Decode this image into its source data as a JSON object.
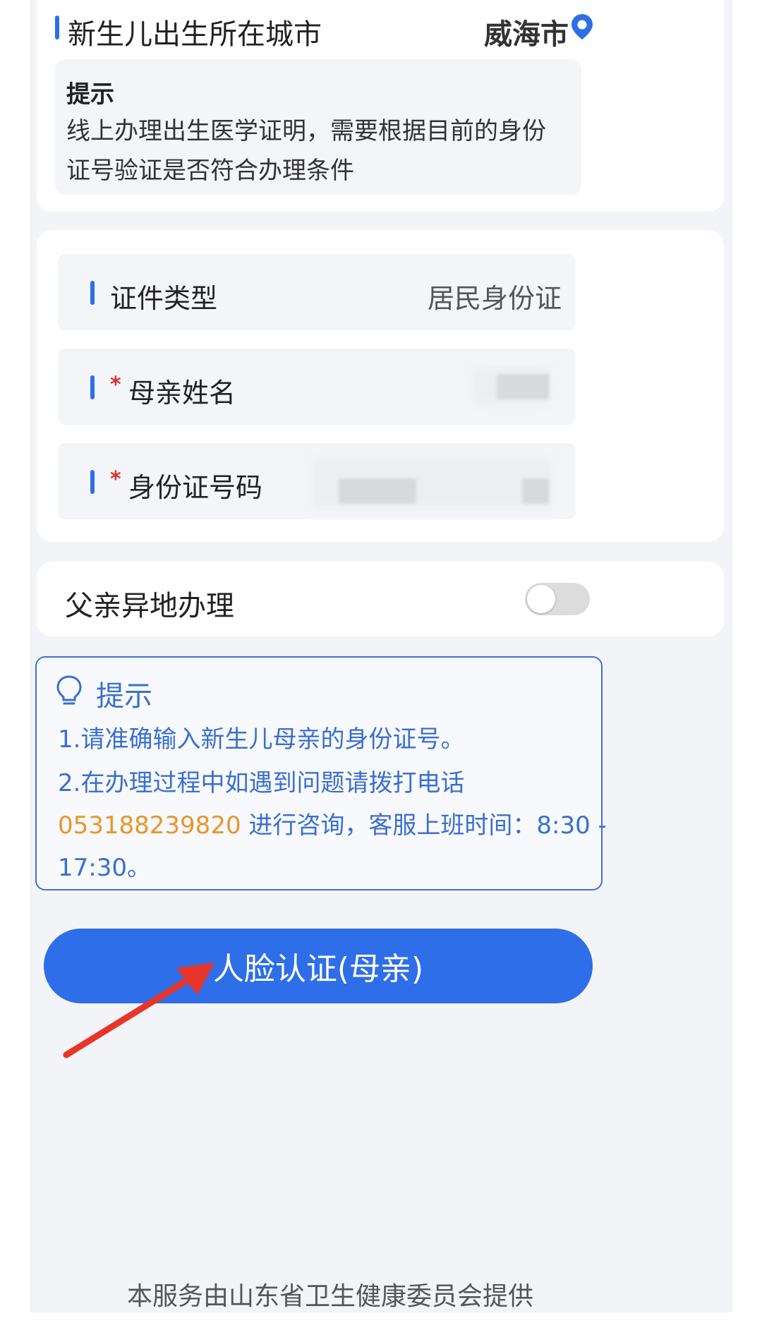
{
  "birth_city": {
    "label": "新生儿出生所在城市",
    "value": "威海市",
    "icon": "location-pin-icon"
  },
  "notice": {
    "title": "提示",
    "text": "线上办理出生医学证明，需要根据目前的身份证号验证是否符合办理条件"
  },
  "form": {
    "id_type": {
      "label": "证件类型",
      "value": "居民身份证"
    },
    "mother_name": {
      "required_mark": "*",
      "label": "母亲姓名"
    },
    "id_number": {
      "required_mark": "*",
      "label": "身份证号码"
    }
  },
  "father_remote": {
    "label": "父亲异地办理",
    "enabled": false
  },
  "tips": {
    "title": "提示",
    "icon": "lightbulb-icon",
    "line1": "1.请准确输入新生儿母亲的身份证号。",
    "line2": "2.在办理过程中如遇到问题请拨打电话",
    "phone": "053188239820",
    "line3_rest": " 进行咨询，客服上班时间：8:30 -",
    "line4": "17:30。"
  },
  "face_auth_button": "人脸认证(母亲)",
  "footer": "本服务由山东省卫生健康委员会提供",
  "colors": {
    "accent": "#2e6ee8",
    "phone_highlight": "#e8952a",
    "required": "#d93030"
  }
}
